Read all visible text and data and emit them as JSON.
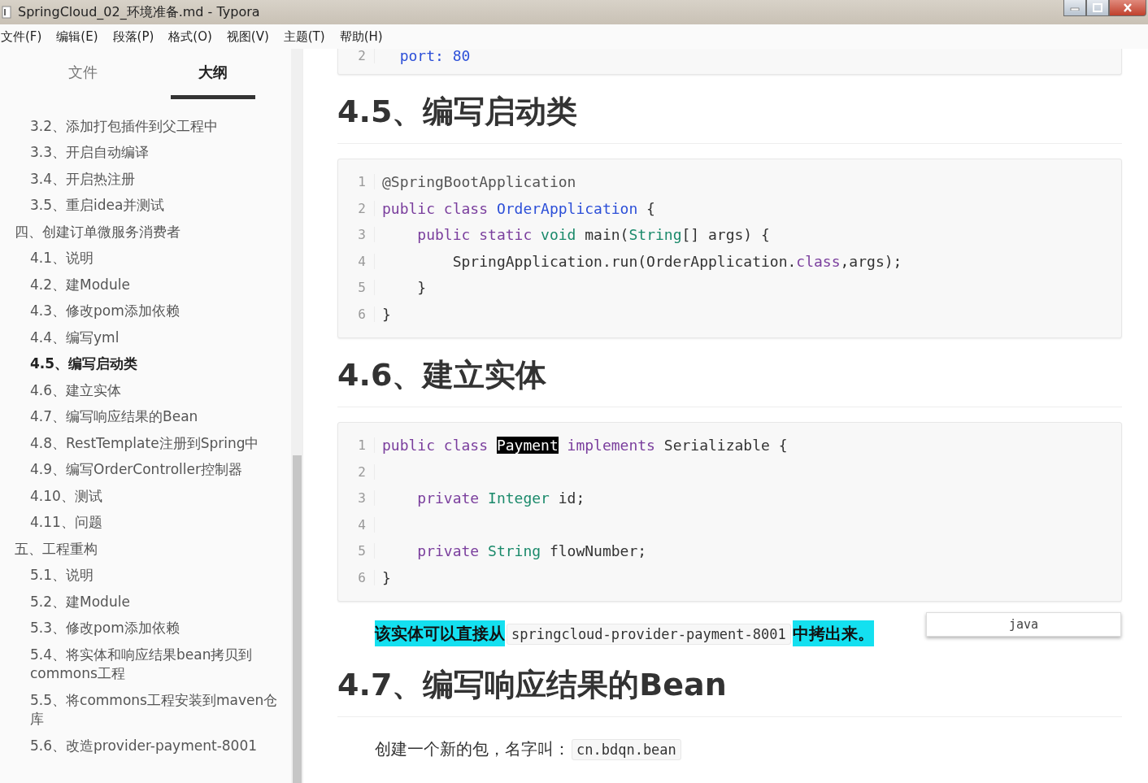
{
  "window": {
    "title": "SpringCloud_02_环境准备.md - Typora"
  },
  "menu": [
    "文件(F)",
    "编辑(E)",
    "段落(P)",
    "格式(O)",
    "视图(V)",
    "主题(T)",
    "帮助(H)"
  ],
  "sidebar": {
    "tabs": [
      {
        "label": "文件",
        "selected": false
      },
      {
        "label": "大纲",
        "selected": true
      }
    ],
    "outline": [
      {
        "children": [
          {
            "label": "3.2、添加打包插件到父工程中",
            "selected": false
          },
          {
            "label": "3.3、开启自动编译",
            "selected": false
          },
          {
            "label": "3.4、开启热注册",
            "selected": false
          },
          {
            "label": "3.5、重启idea并测试",
            "selected": false
          }
        ]
      },
      {
        "label": "四、创建订单微服务消费者",
        "selected": false,
        "children": [
          {
            "label": "4.1、说明",
            "selected": false
          },
          {
            "label": "4.2、建Module",
            "selected": false
          },
          {
            "label": "4.3、修改pom添加依赖",
            "selected": false
          },
          {
            "label": "4.4、编写yml",
            "selected": false
          },
          {
            "label": "4.5、编写启动类",
            "selected": true
          },
          {
            "label": "4.6、建立实体",
            "selected": false
          },
          {
            "label": "4.7、编写响应结果的Bean",
            "selected": false
          },
          {
            "label": "4.8、RestTemplate注册到Spring中",
            "selected": false
          },
          {
            "label": "4.9、编写OrderController控制器",
            "selected": false
          },
          {
            "label": "4.10、测试",
            "selected": false
          },
          {
            "label": "4.11、问题",
            "selected": false
          }
        ]
      },
      {
        "label": "五、工程重构",
        "selected": false,
        "children": [
          {
            "label": "5.1、说明",
            "selected": false
          },
          {
            "label": "5.2、建Module",
            "selected": false
          },
          {
            "label": "5.3、修改pom添加依赖",
            "selected": false
          },
          {
            "label": "5.4、将实体和响应结果bean拷贝到commons工程",
            "selected": false
          },
          {
            "label": "5.5、将commons工程安装到maven仓库",
            "selected": false
          },
          {
            "label": "5.6、改造provider-payment-8001",
            "selected": false
          }
        ]
      }
    ]
  },
  "document": [
    {
      "kind": "code_cut",
      "lines": [
        {
          "number": "2",
          "tokens": [
            {
              "t": "  port: 80",
              "kind": "classname"
            }
          ]
        }
      ]
    },
    {
      "kind": "heading",
      "text": "4.5、编写启动类"
    },
    {
      "kind": "code",
      "lines": [
        {
          "number": "1",
          "tokens": [
            {
              "t": "@SpringBootApplication",
              "kind": "annotation"
            }
          ]
        },
        {
          "number": "2",
          "tokens": [
            {
              "t": "public class ",
              "kind": "keyword"
            },
            {
              "t": "OrderApplication",
              "kind": "classname"
            },
            {
              "t": " {",
              "kind": "plain"
            }
          ]
        },
        {
          "number": "3",
          "tokens": [
            {
              "t": "    public static ",
              "kind": "keyword"
            },
            {
              "t": "void",
              "kind": "type"
            },
            {
              "t": " main(",
              "kind": "plain"
            },
            {
              "t": "String",
              "kind": "type"
            },
            {
              "t": "[] args) {",
              "kind": "plain"
            }
          ]
        },
        {
          "number": "4",
          "tokens": [
            {
              "t": "        SpringApplication.run(OrderApplication.",
              "kind": "plain"
            },
            {
              "t": "class",
              "kind": "keyword"
            },
            {
              "t": ",args);",
              "kind": "plain"
            }
          ]
        },
        {
          "number": "5",
          "tokens": [
            {
              "t": "    }",
              "kind": "plain"
            }
          ]
        },
        {
          "number": "6",
          "tokens": [
            {
              "t": "}",
              "kind": "plain"
            }
          ]
        }
      ]
    },
    {
      "kind": "heading",
      "text": "4.6、建立实体"
    },
    {
      "kind": "code",
      "language": "java",
      "lines": [
        {
          "number": "1",
          "tokens": [
            {
              "t": "public class ",
              "kind": "keyword"
            },
            {
              "t": "Payment",
              "kind": "selected"
            },
            {
              "t": " implements ",
              "kind": "keyword"
            },
            {
              "t": "Serializable {",
              "kind": "plain"
            }
          ]
        },
        {
          "number": "2"
        },
        {
          "number": "3",
          "tokens": [
            {
              "t": "    private ",
              "kind": "keyword"
            },
            {
              "t": "Integer",
              "kind": "type"
            },
            {
              "t": " id;",
              "kind": "plain"
            }
          ]
        },
        {
          "number": "4"
        },
        {
          "number": "5",
          "tokens": [
            {
              "t": "    private ",
              "kind": "keyword"
            },
            {
              "t": "String",
              "kind": "type"
            },
            {
              "t": " flowNumber;",
              "kind": "plain"
            }
          ]
        },
        {
          "number": "6",
          "tokens": [
            {
              "t": "}",
              "kind": "plain"
            }
          ]
        }
      ]
    },
    {
      "kind": "paragraph",
      "parts": [
        {
          "t": "该实体可以直接从",
          "kind": "highlight"
        },
        {
          "t": "springcloud-provider-payment-8001",
          "kind": "code"
        },
        {
          "t": "中拷出来。",
          "kind": "highlight"
        }
      ]
    },
    {
      "kind": "heading",
      "text": "4.7、编写响应结果的Bean"
    },
    {
      "kind": "paragraph",
      "parts": [
        {
          "t": "创建一个新的包，名字叫：",
          "kind": "text"
        },
        {
          "t": "cn.bdqn.bean",
          "kind": "code"
        }
      ]
    }
  ]
}
